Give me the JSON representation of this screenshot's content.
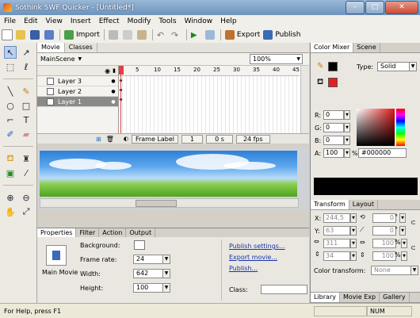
{
  "window": {
    "title": "Sothink SWF Quicker - [Untitled*]",
    "minimize": "–",
    "maximize": "□",
    "close": "✕"
  },
  "menu": [
    "File",
    "Edit",
    "View",
    "Insert",
    "Effect",
    "Modify",
    "Tools",
    "Window",
    "Help"
  ],
  "toolbar": {
    "import_label": "Import",
    "export_label": "Export",
    "publish_label": "Publish"
  },
  "center_tabs": [
    "Movie",
    "Classes"
  ],
  "scene": {
    "name": "MainScene",
    "zoom": "100%"
  },
  "timeline": {
    "ruler": [
      "5",
      "10",
      "15",
      "20",
      "25",
      "30",
      "35",
      "40",
      "45"
    ],
    "layers": [
      {
        "name": "Layer 3",
        "selected": false
      },
      {
        "name": "Layer 2",
        "selected": false
      },
      {
        "name": "Layer 1",
        "selected": true
      }
    ],
    "frame_label": "Frame Label",
    "current_frame": "1",
    "time": "0 s",
    "fps": "24 fps"
  },
  "props": {
    "tabs": [
      "Properties",
      "Filter",
      "Action",
      "Output"
    ],
    "main_movie": "Main Movie",
    "background_label": "Background:",
    "frame_rate_label": "Frame rate:",
    "frame_rate": "24",
    "width_label": "Width:",
    "width": "642",
    "height_label": "Height:",
    "height": "100",
    "publish_settings": "Publish settings...",
    "export_movie": "Export movie...",
    "publish": "Publish...",
    "class_label": "Class:"
  },
  "color_mixer": {
    "tabs": [
      "Color Mixer",
      "Scene"
    ],
    "type_label": "Type:",
    "type_value": "Solid",
    "r_label": "R:",
    "r": "0",
    "g_label": "G:",
    "g": "0",
    "b_label": "B:",
    "b": "0",
    "a_label": "A:",
    "a": "100",
    "pct": "%",
    "hex": "#000000",
    "stroke_color": "#000000",
    "fill_color": "#e02020"
  },
  "transform": {
    "tabs": [
      "Transform",
      "Layout"
    ],
    "x_label": "X:",
    "x": "244,5",
    "y_label": "Y:",
    "y": "63",
    "w": "311",
    "h": "34",
    "rot1": "0",
    "rot2": "0",
    "deg": "°",
    "sx": "100",
    "sy": "100",
    "pct": "%",
    "color_transform_label": "Color transform:",
    "color_transform": "None"
  },
  "bottom_tabs": [
    "Library",
    "Movie Exp",
    "Gallery"
  ],
  "status": {
    "help": "For Help, press F1",
    "num": "NUM"
  }
}
